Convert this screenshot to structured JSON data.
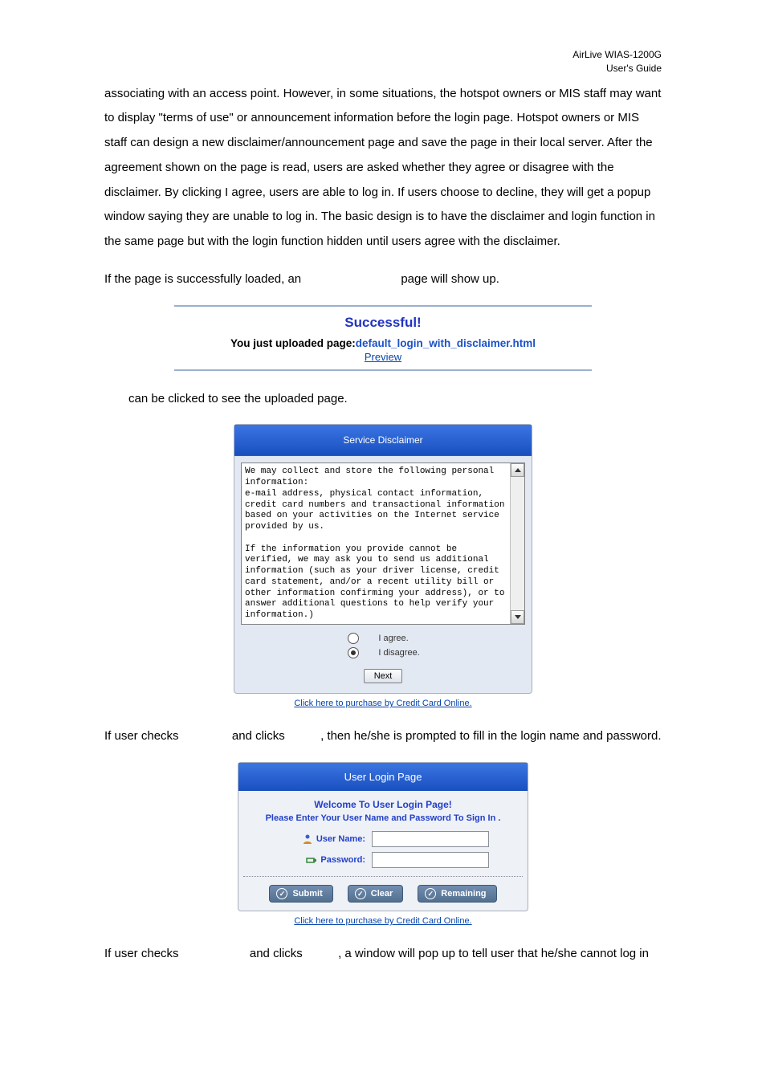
{
  "header": {
    "line1": "AirLive WIAS-1200G",
    "line2": "User's Guide"
  },
  "paragraphs": {
    "intro": "associating with an access point. However, in some situations, the hotspot owners or MIS staff may want to display \"terms of use\" or announcement information before the login page. Hotspot owners or MIS staff can design a new disclaimer/announcement page and save the page in their local server. After the agreement shown on the page is read, users are asked whether they agree or disagree with the disclaimer. By clicking I agree, users are able to log in. If users choose to decline, they will get a popup window saying they are unable to log in. The basic design is to have the disclaimer and login function in the same page but with the login function hidden until users agree with the disclaimer.",
    "if_loaded_pre": "If the page is successfully loaded, an",
    "if_loaded_post": " page will show up.",
    "preview_sentence": " can be clicked to see the uploaded page.",
    "if_agree_pre": "If user checks ",
    "if_agree_mid": " and clicks ",
    "if_agree_post": ", then he/she is prompted to fill in the login name and password.",
    "if_disagree_pre": "If user checks ",
    "if_disagree_mid": " and clicks ",
    "if_disagree_post": ", a window will pop up to tell user that he/she cannot log in"
  },
  "success": {
    "title": "Successful!",
    "uploaded_prefix": "You just uploaded page:",
    "uploaded_file": "default_login_with_disclaimer.html",
    "preview_label": "Preview"
  },
  "disclaimer": {
    "header": "Service Disclaimer",
    "text": "We may collect and store the following personal information:\ne-mail address, physical contact information, credit card numbers and transactional information based on your activities on the Internet service provided by us.\n\nIf the information you provide cannot be verified, we may ask you to send us additional information (such as your driver license, credit card statement, and/or a recent utility bill or other information confirming your address), or to answer additional questions to help verify your information.)",
    "agree_label": "I agree.",
    "disagree_label": "I disagree.",
    "next_label": "Next"
  },
  "cc_link": "Click here to purchase by Credit Card Online.",
  "login": {
    "header": "User Login Page",
    "welcome": "Welcome To User Login Page!",
    "sub": "Please Enter Your User Name and Password To Sign In .",
    "username_label": "User Name:",
    "password_label": "Password:",
    "submit_label": "Submit",
    "clear_label": "Clear",
    "remaining_label": "Remaining"
  }
}
